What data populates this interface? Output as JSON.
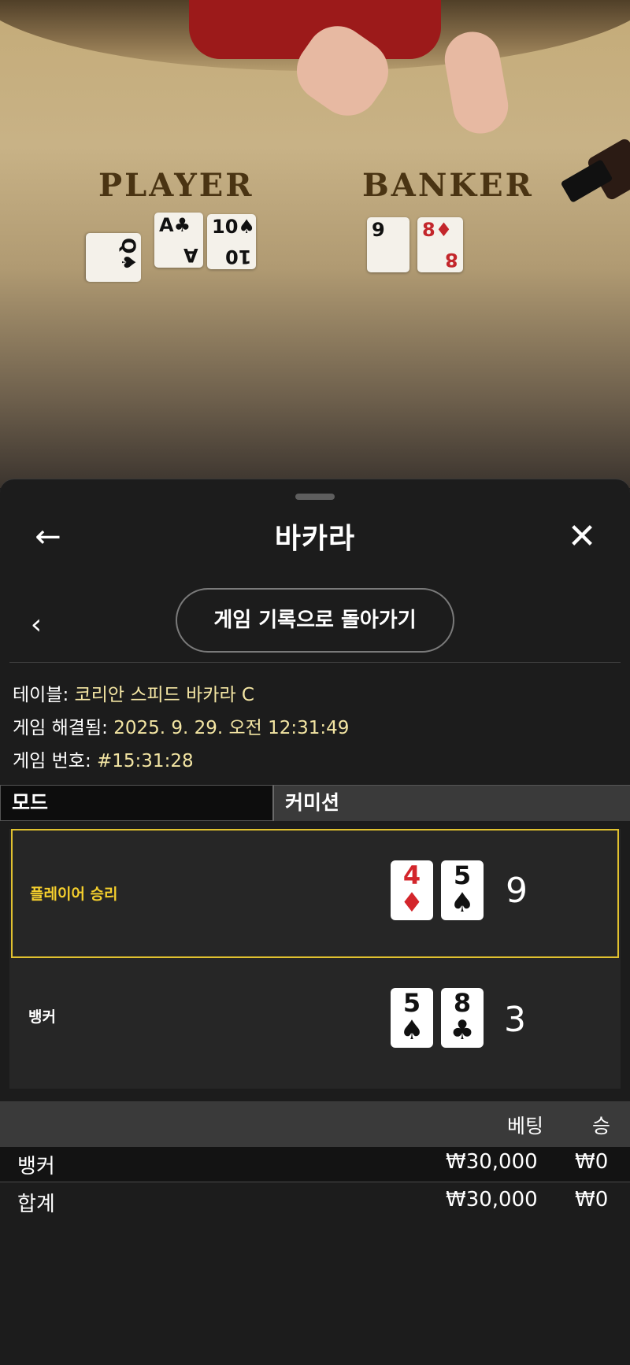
{
  "video": {
    "player_label": "PLAYER",
    "banker_label": "BANKER",
    "player_cards": [
      {
        "rank": "Q",
        "suit": "♠",
        "color": "black"
      },
      {
        "rank": "A",
        "suit": "♣",
        "color": "black"
      },
      {
        "rank": "10",
        "suit": "♠",
        "color": "black"
      }
    ],
    "banker_cards": [
      {
        "rank": "9",
        "suit": "",
        "color": "black"
      },
      {
        "rank": "8",
        "suit": "♦",
        "color": "red"
      }
    ]
  },
  "header": {
    "back_icon": "←",
    "title": "바카라",
    "close_icon": "✕"
  },
  "nav": {
    "prev_icon": "‹",
    "history_button": "게임 기록으로 돌아가기"
  },
  "info": {
    "table_key": "테이블:",
    "table_value": "코리안 스피드 바카라 C",
    "resolved_key": "게임 해결됨:",
    "resolved_value": "2025. 9. 29. 오전 12:31:49",
    "number_key": "게임 번호:",
    "number_value": "#15:31:28"
  },
  "tabs": {
    "mode": "모드",
    "commission": "커미션"
  },
  "results": {
    "player": {
      "label": "플레이어 승리",
      "score": "9",
      "cards": [
        {
          "rank": "4",
          "suit": "♦",
          "color": "red"
        },
        {
          "rank": "5",
          "suit": "♠",
          "color": "black"
        }
      ]
    },
    "banker": {
      "label": "뱅커",
      "score": "3",
      "cards": [
        {
          "rank": "5",
          "suit": "♠",
          "color": "black"
        },
        {
          "rank": "8",
          "suit": "♣",
          "color": "black"
        }
      ]
    }
  },
  "bets": {
    "col_bet": "베팅",
    "col_win": "승",
    "rows": [
      {
        "name": "뱅커",
        "bet": "₩30,000",
        "win": "₩0"
      },
      {
        "name": "합계",
        "bet": "₩30,000",
        "win": "₩0"
      }
    ]
  },
  "colors": {
    "win_border": "#e0c12f",
    "win_label": "#f5cf2d",
    "info_value": "#f3e5a3",
    "red_suit": "#d3252b"
  }
}
